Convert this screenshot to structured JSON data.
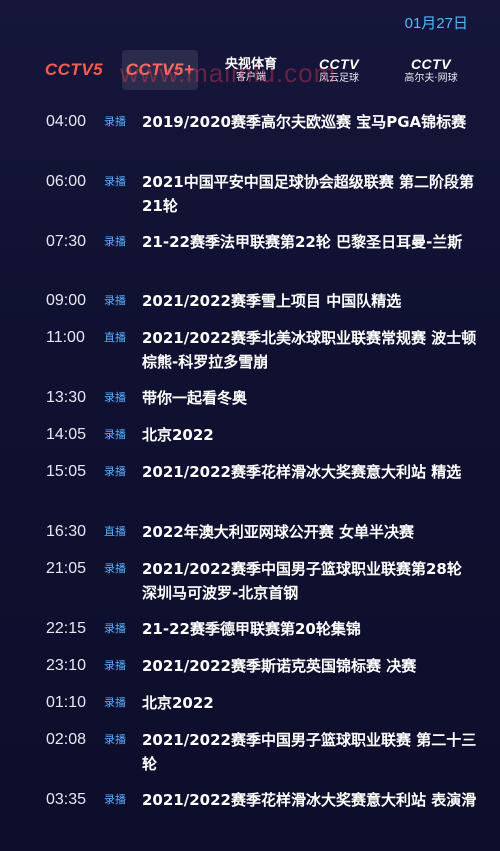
{
  "header": {
    "date": "01月27日",
    "watermark": "www.maimiu.com",
    "channels": [
      {
        "logo": "CCTV5",
        "sub": ""
      },
      {
        "logo": "CCTV5+",
        "sub": ""
      },
      {
        "logo": "央视体育",
        "sub": "客户端"
      },
      {
        "logo": "CCTV",
        "sub": "风云足球"
      },
      {
        "logo": "CCTV",
        "sub": "高尔夫·网球"
      }
    ],
    "colors": {
      "date": "#4fb8ff",
      "tag": "#5aaeff",
      "cctv5": "#ff5a4e"
    }
  },
  "programs": [
    {
      "time": "04:00",
      "tag": "录播",
      "title": "2019/2020赛季高尔夫欧巡赛 宝马PGA锦标赛"
    },
    {
      "time": "06:00",
      "tag": "录播",
      "title": "2021中国平安中国足球协会超级联赛 第二阶段第21轮"
    },
    {
      "time": "07:30",
      "tag": "录播",
      "title": "21-22赛季法甲联赛第22轮 巴黎圣日耳曼-兰斯"
    },
    {
      "time": "09:00",
      "tag": "录播",
      "title": "2021/2022赛季雪上项目 中国队精选"
    },
    {
      "time": "11:00",
      "tag": "直播",
      "title": "2021/2022赛季北美冰球职业联赛常规赛 波士顿棕熊-科罗拉多雪崩"
    },
    {
      "time": "13:30",
      "tag": "录播",
      "title": "带你一起看冬奥"
    },
    {
      "time": "14:05",
      "tag": "录播",
      "title": "北京2022"
    },
    {
      "time": "15:05",
      "tag": "录播",
      "title": "2021/2022赛季花样滑冰大奖赛意大利站 精选"
    },
    {
      "time": "16:30",
      "tag": "直播",
      "title": "2022年澳大利亚网球公开赛 女单半决赛"
    },
    {
      "time": "21:05",
      "tag": "录播",
      "title": "2021/2022赛季中国男子篮球职业联赛第28轮 深圳马可波罗-北京首钢"
    },
    {
      "time": "22:15",
      "tag": "录播",
      "title": "21-22赛季德甲联赛第20轮集锦"
    },
    {
      "time": "23:10",
      "tag": "录播",
      "title": "2021/2022赛季斯诺克英国锦标赛 决赛"
    },
    {
      "time": "01:10",
      "tag": "录播",
      "title": "北京2022"
    },
    {
      "time": "02:08",
      "tag": "录播",
      "title": "2021/2022赛季中国男子篮球职业联赛 第二十三轮"
    },
    {
      "time": "03:35",
      "tag": "录播",
      "title": "2021/2022赛季花样滑冰大奖赛意大利站 表演滑"
    }
  ]
}
